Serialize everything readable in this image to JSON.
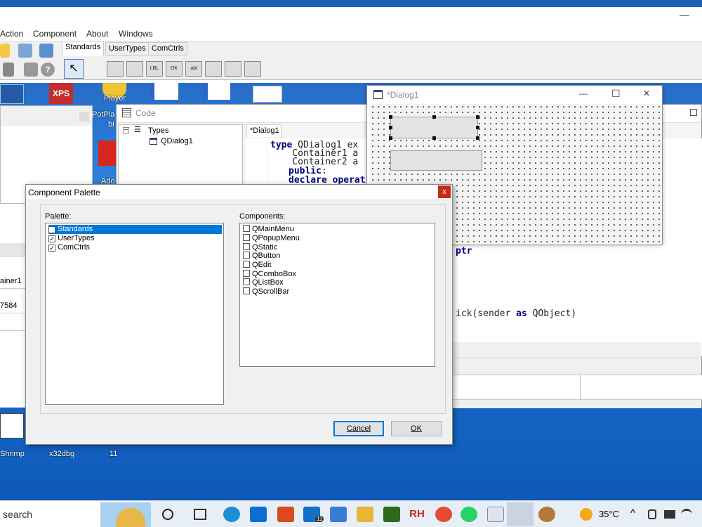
{
  "ide": {
    "menu": [
      "Action",
      "Component",
      "About",
      "Windows"
    ],
    "tabs": [
      "Standards",
      "UserTypes",
      "ComCtrls"
    ],
    "components_row": [
      "LBL",
      "OK",
      "abl"
    ]
  },
  "desktop": {
    "icons": [
      {
        "label": "PotPla",
        "sub": "bi"
      },
      {
        "label": "Player"
      },
      {
        "label": "Ado"
      },
      {
        "label": "Shrimp"
      },
      {
        "label": "x32dbg"
      },
      {
        "label": "11"
      }
    ],
    "xps": "XPS"
  },
  "leftwin": {
    "cells": [
      "ainer1",
      "7584"
    ]
  },
  "code_window": {
    "title": "Code",
    "tree_root": "Types",
    "tree_child": "QDialog1",
    "tab": "*Dialog1",
    "lines": [
      {
        "kw": "type",
        "rest": " QDialog1 ex"
      },
      {
        "kw": "",
        "rest": "    Container1 a"
      },
      {
        "kw": "",
        "rest": "    Container2 a"
      },
      {
        "kw": "public",
        "rest": ":"
      },
      {
        "kw": "declare operat",
        "rest": ""
      }
    ],
    "line_ptr": "ptr",
    "line_click": "ick(sender ",
    "line_as": "as",
    "line_obj": " QObject)"
  },
  "dialog_designer": {
    "title": "*Dialog1",
    "min": "—",
    "max": "☐",
    "close": "✕"
  },
  "palette": {
    "title": "Component Palette",
    "close": "x",
    "palette_label": "Palette:",
    "components_label": "Components:",
    "palette_items": [
      {
        "label": "Standards",
        "checked": true,
        "selected": true
      },
      {
        "label": "UserTypes",
        "checked": true,
        "selected": false
      },
      {
        "label": "ComCtrls",
        "checked": true,
        "selected": false
      }
    ],
    "component_items": [
      "QMainMenu",
      "QPopupMenu",
      "QStatic",
      "QButton",
      "QEdit",
      "QComboBox",
      "QListBox",
      "QScrollBar"
    ],
    "cancel": "Cancel",
    "ok": "OK"
  },
  "taskbar": {
    "search": "search",
    "badge": "11",
    "weather": "35°C",
    "apps": [
      "RH"
    ]
  }
}
